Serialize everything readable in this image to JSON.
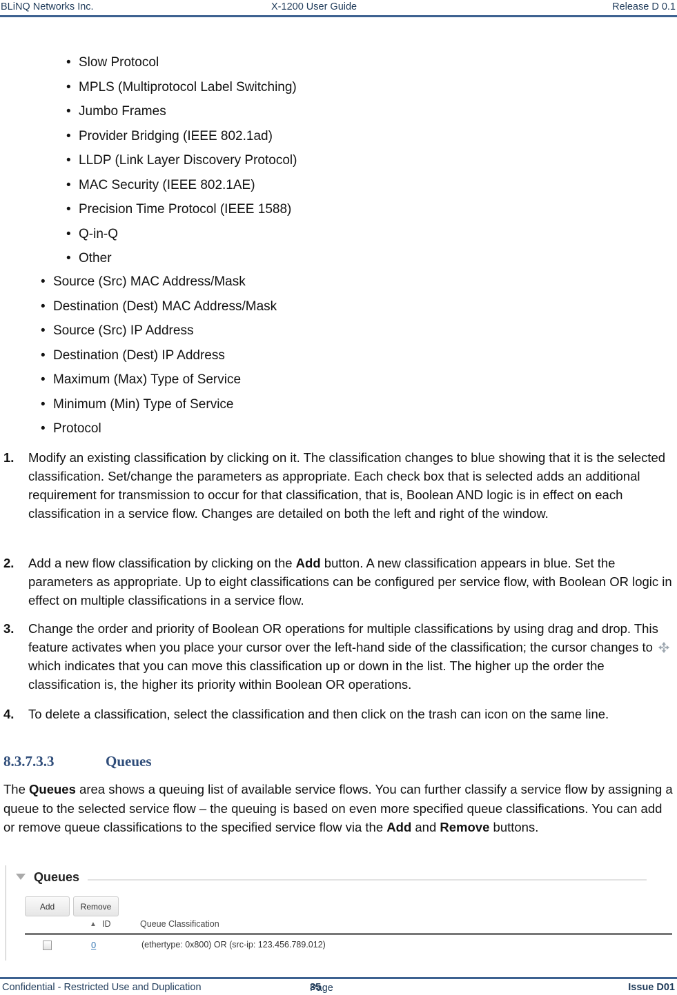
{
  "header": {
    "left": "BLiNQ Networks Inc.",
    "center": "X-1200 User Guide",
    "right": "Release D 0.1"
  },
  "sub_bullets": [
    "Slow Protocol",
    "MPLS (Multiprotocol Label Switching)",
    "Jumbo Frames",
    "Provider Bridging (IEEE 802.1ad)",
    "LLDP (Link Layer Discovery Protocol)",
    "MAC Security (IEEE 802.1AE)",
    "Precision Time Protocol (IEEE 1588)",
    "Q-in-Q",
    "Other"
  ],
  "bullets": [
    "Source (Src) MAC Address/Mask",
    "Destination (Dest) MAC Address/Mask",
    "Source (Src) IP Address",
    "Destination (Dest) IP Address",
    "Maximum (Max) Type of Service",
    "Minimum (Min) Type of Service",
    "Protocol"
  ],
  "bullet_glyph": "•",
  "steps": [
    {
      "num": "1.",
      "text": "Modify an existing classification by clicking on it. The classification changes to blue showing that it is the selected classification. Set/change the parameters as appropriate. Each check box that is selected adds an additional requirement for transmission to occur for that classification, that is, Boolean AND logic is in effect on each classification in a service flow. Changes are detailed on both the left and right of the window."
    },
    {
      "num": "2.",
      "pre": "Add a new flow classification by clicking on the ",
      "bold": "Add",
      "post": " button. A new classification appears in blue. Set the parameters as appropriate. Up to eight classifications can be configured per service flow, with Boolean OR logic in effect on multiple classifications in a service flow."
    },
    {
      "num": "3.",
      "pre": "Change the order and priority of Boolean OR operations for multiple classifications by using drag and drop. This feature activates when you place your cursor over the left-hand side of the classification; the cursor changes to",
      "icon": "move-cursor-icon",
      "post": "which indicates that you can move this classification up or down in the list. The higher up the order the classification is, the higher its priority within Boolean OR operations."
    },
    {
      "num": "4.",
      "text": "To delete a classification, select the classification and then click on the trash can icon on the same line."
    }
  ],
  "section": {
    "number": "8.3.7.3.3",
    "title": "Queues"
  },
  "paragraph": {
    "p1": "The ",
    "b1": "Queues",
    "p2": " area shows a queuing list of available service flows. You can further classify a service flow by assigning a queue to the selected service flow – the queuing is based on even more specified queue classifications. You can add or remove queue classifications to the specified service flow via the ",
    "b2": "Add",
    "p3": " and ",
    "b3": "Remove",
    "p4": " buttons."
  },
  "queues_panel": {
    "title": "Queues",
    "collapse_icon": "triangle-down-icon",
    "buttons": {
      "add": "Add",
      "remove": "Remove"
    },
    "columns": {
      "sort_glyph": "▲",
      "id": "ID",
      "classification": "Queue Classification"
    },
    "rows": [
      {
        "checked": false,
        "id": "0",
        "classification": "(ethertype: 0x800) OR (src-ip: 123.456.789.012)"
      }
    ]
  },
  "footer": {
    "left": "Confidential - Restricted Use and Duplication",
    "page_label": "Page ",
    "page_number": "35",
    "right": "Issue D01"
  }
}
